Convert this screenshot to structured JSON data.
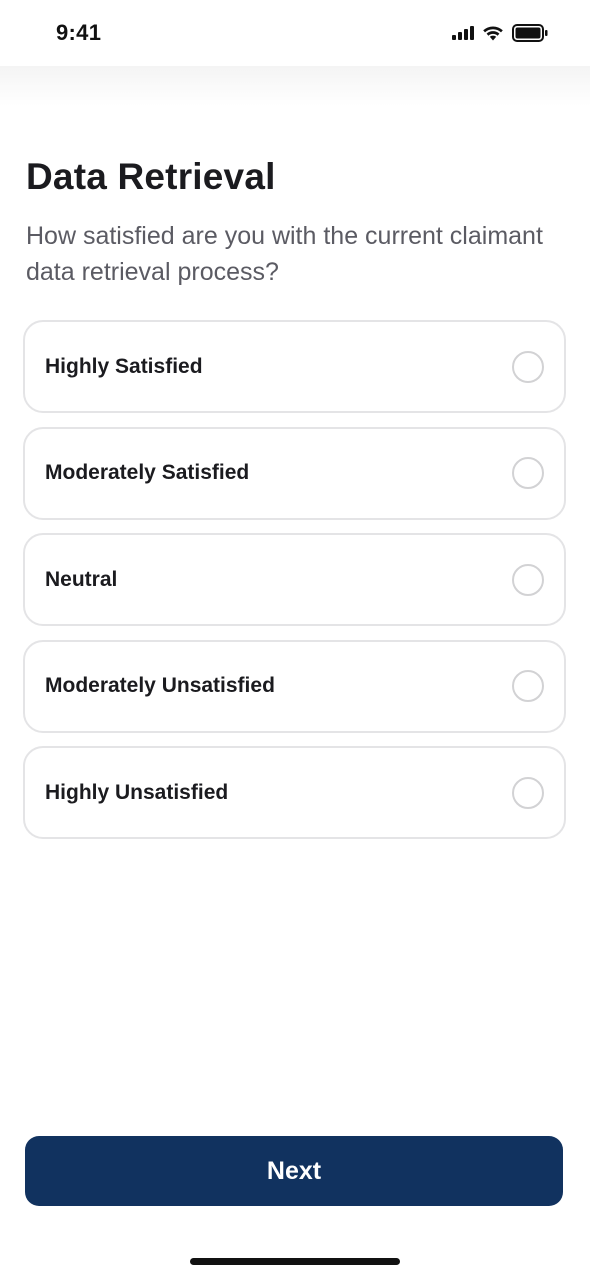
{
  "status_bar": {
    "time": "9:41",
    "icons": [
      "cellular-signal-icon",
      "wifi-icon",
      "battery-icon"
    ]
  },
  "question": {
    "title": "Data Retrieval",
    "prompt": "How satisfied are you with the current claimant data retrieval process?"
  },
  "options": [
    {
      "label": "Highly Satisfied",
      "selected": false
    },
    {
      "label": "Moderately Satisfied",
      "selected": false
    },
    {
      "label": "Neutral",
      "selected": false
    },
    {
      "label": "Moderately Unsatisfied",
      "selected": false
    },
    {
      "label": "Highly Unsatisfied",
      "selected": false
    }
  ],
  "footer": {
    "next_label": "Next"
  },
  "colors": {
    "primary": "#11325f",
    "border": "#e4e4e6",
    "radio_border": "#d2d2d4",
    "text": "#1b1b1f",
    "subtext": "#5b5b63"
  }
}
